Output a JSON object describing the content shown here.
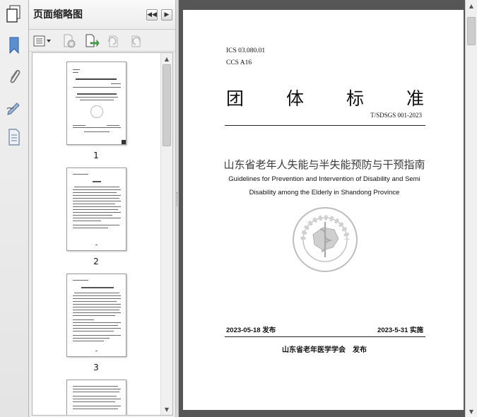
{
  "panel": {
    "title": "页面缩略图",
    "thumbnails": [
      {
        "page_label": "1"
      },
      {
        "page_label": "2"
      },
      {
        "page_label": "3"
      }
    ]
  },
  "document": {
    "ics": "ICS 03.080.01",
    "ccs": "CCS A16",
    "std_type": [
      "团",
      "体",
      "标",
      "准"
    ],
    "std_number": "T/SDSGS 001-2023",
    "title_cn": "山东省老年人失能与半失能预防与干预指南",
    "title_en_line1": "Guidelines for Prevention and Intervention of Disability and Semi",
    "title_en_line2": "Disability among the Elderly in Shandong Province",
    "publish_date": "2023-05-18 发布",
    "effective_date": "2023-5-31 实施",
    "publisher": "山东省老年医学学会　发布",
    "seal_text": "山东省老年医学学会",
    "seal_text_en": "SHANDONG GERIATRICS SOCIETY"
  },
  "colors": {
    "title_cn": "#3a3a3a",
    "viewer_bg": "#565656",
    "seal": "#b8b8b8"
  }
}
